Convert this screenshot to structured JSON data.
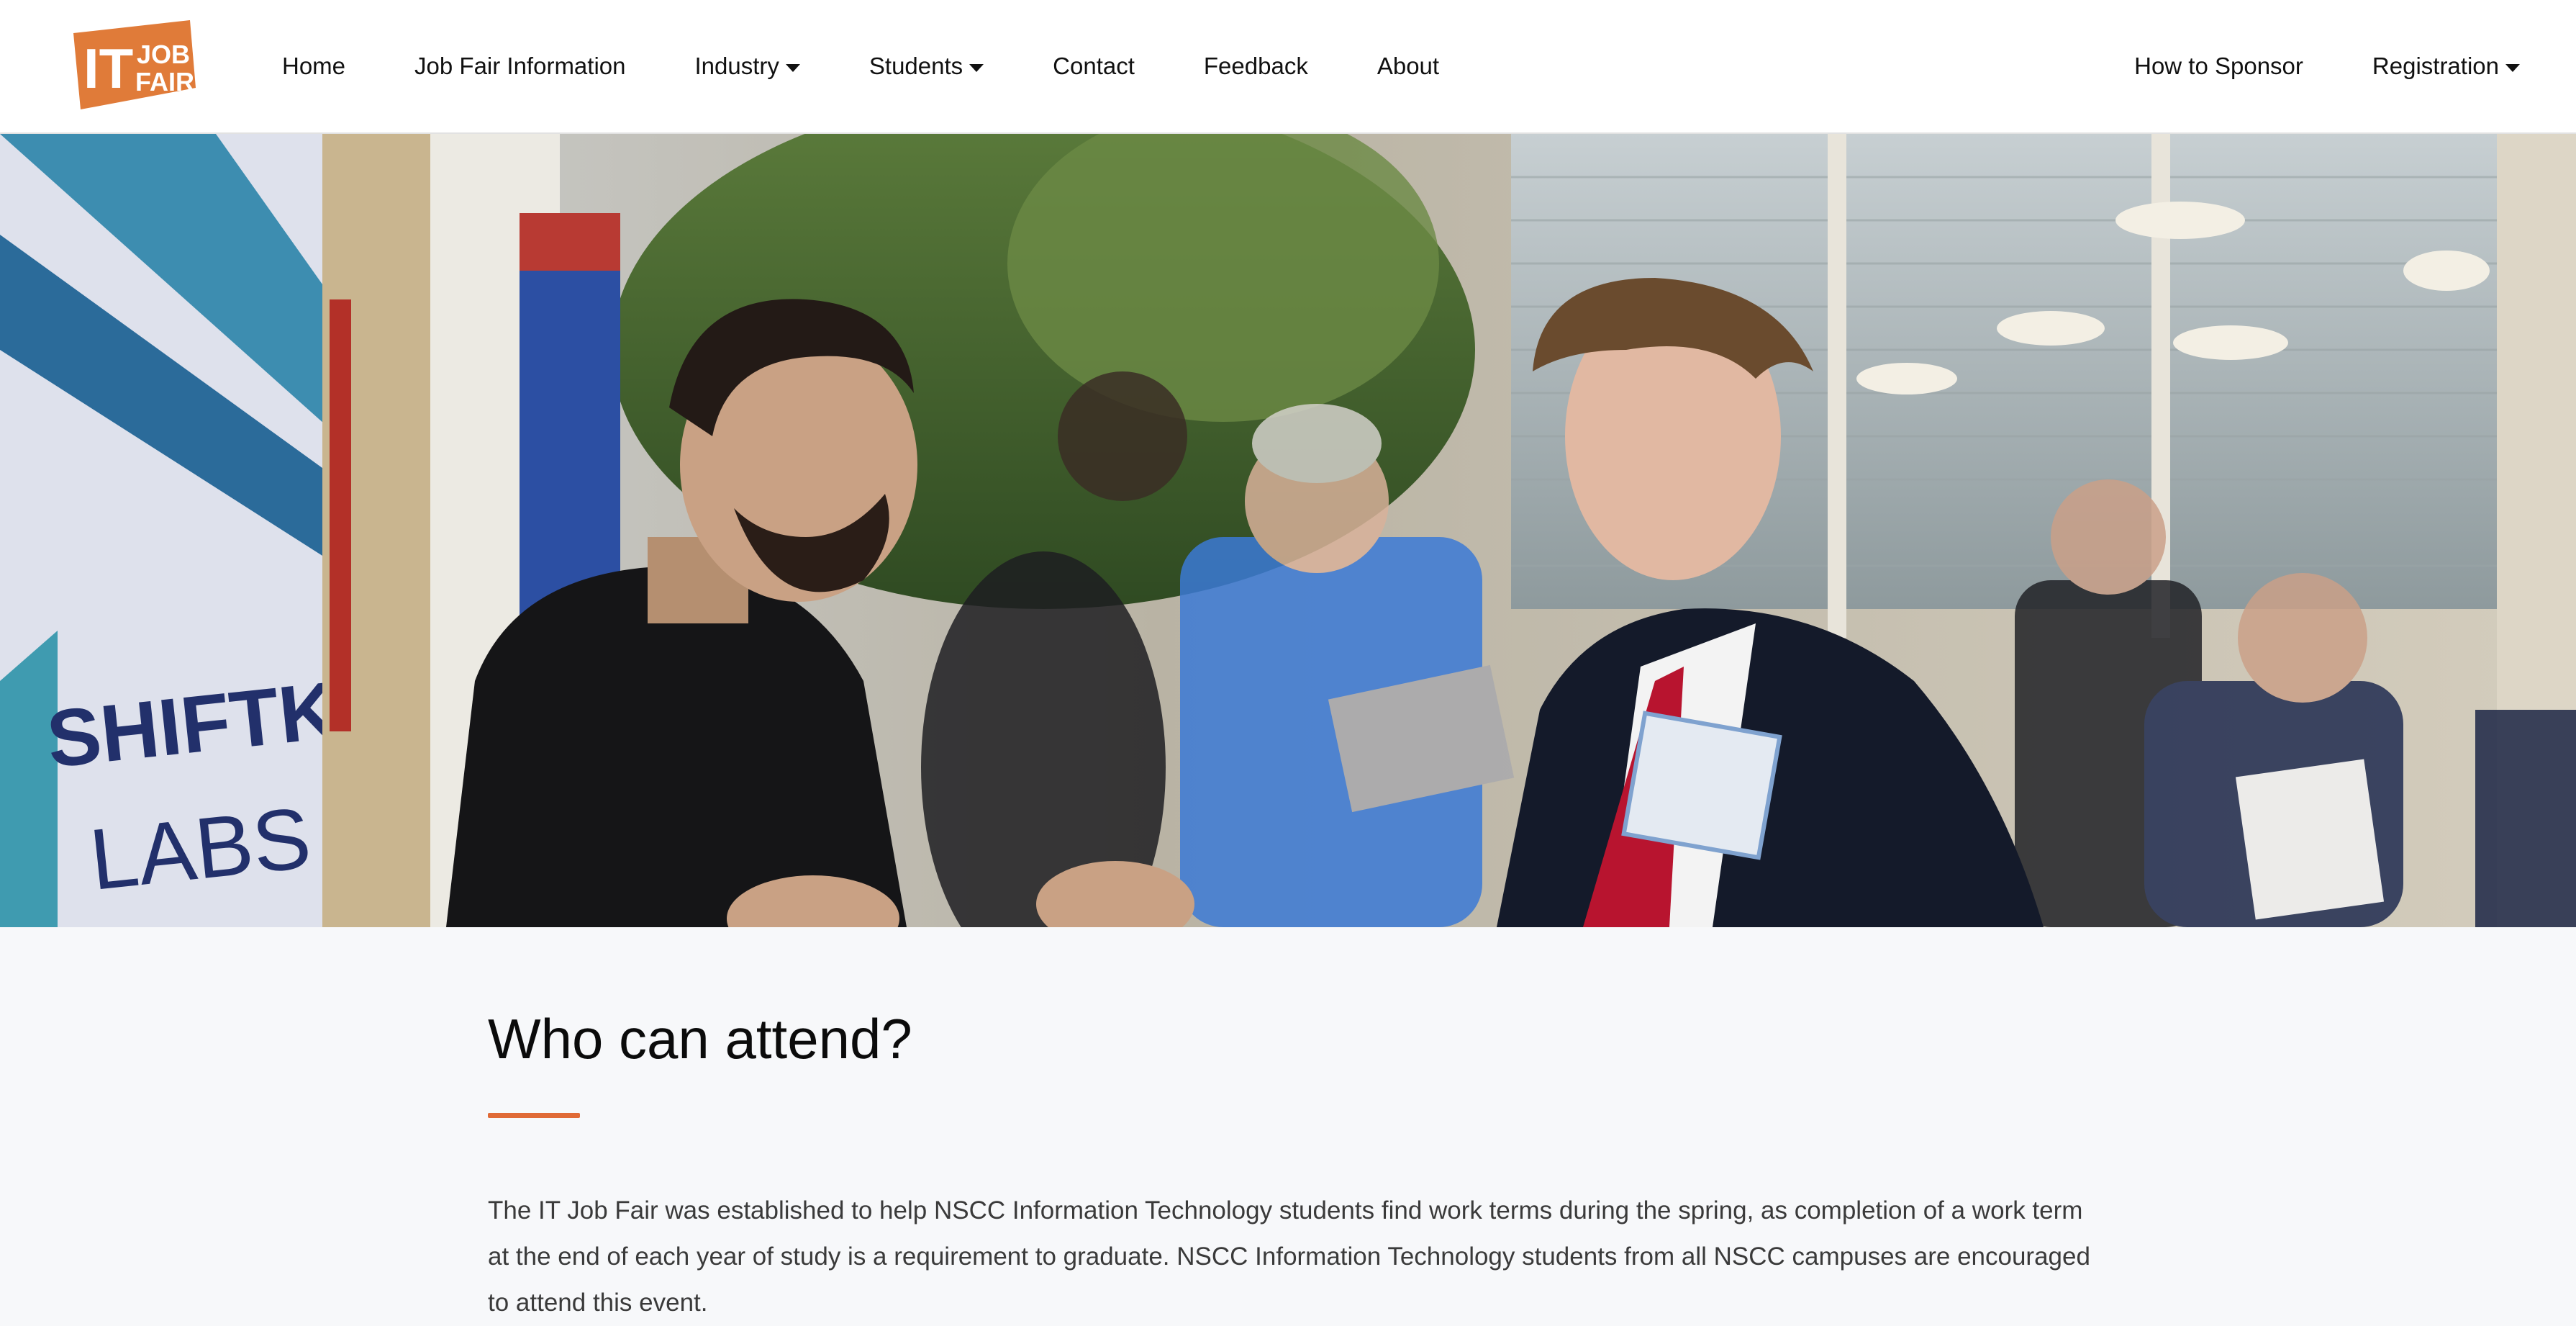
{
  "logo": {
    "line1": "IT",
    "line2": "JOB",
    "line3": "FAIR",
    "color": "#e07b39"
  },
  "nav": {
    "left": [
      {
        "label": "Home",
        "dropdown": false
      },
      {
        "label": "Job Fair Information",
        "dropdown": false
      },
      {
        "label": "Industry",
        "dropdown": true
      },
      {
        "label": "Students",
        "dropdown": true
      },
      {
        "label": "Contact",
        "dropdown": false
      },
      {
        "label": "Feedback",
        "dropdown": false
      },
      {
        "label": "About",
        "dropdown": false
      }
    ],
    "right": [
      {
        "label": "How to Sponsor",
        "dropdown": false
      },
      {
        "label": "Registration",
        "dropdown": true
      }
    ]
  },
  "hero": {
    "banner_text_line1": "SHIFTKEY",
    "banner_text_line2": "LABS"
  },
  "section": {
    "heading": "Who can attend?",
    "accent_color": "#e06a36",
    "paragraph": "The IT Job Fair was established to help NSCC Information Technology students find work terms during the spring, as completion of a work term at the end of each year of study is a requirement to graduate. NSCC Information Technology students from all NSCC campuses are encouraged to attend this event."
  }
}
